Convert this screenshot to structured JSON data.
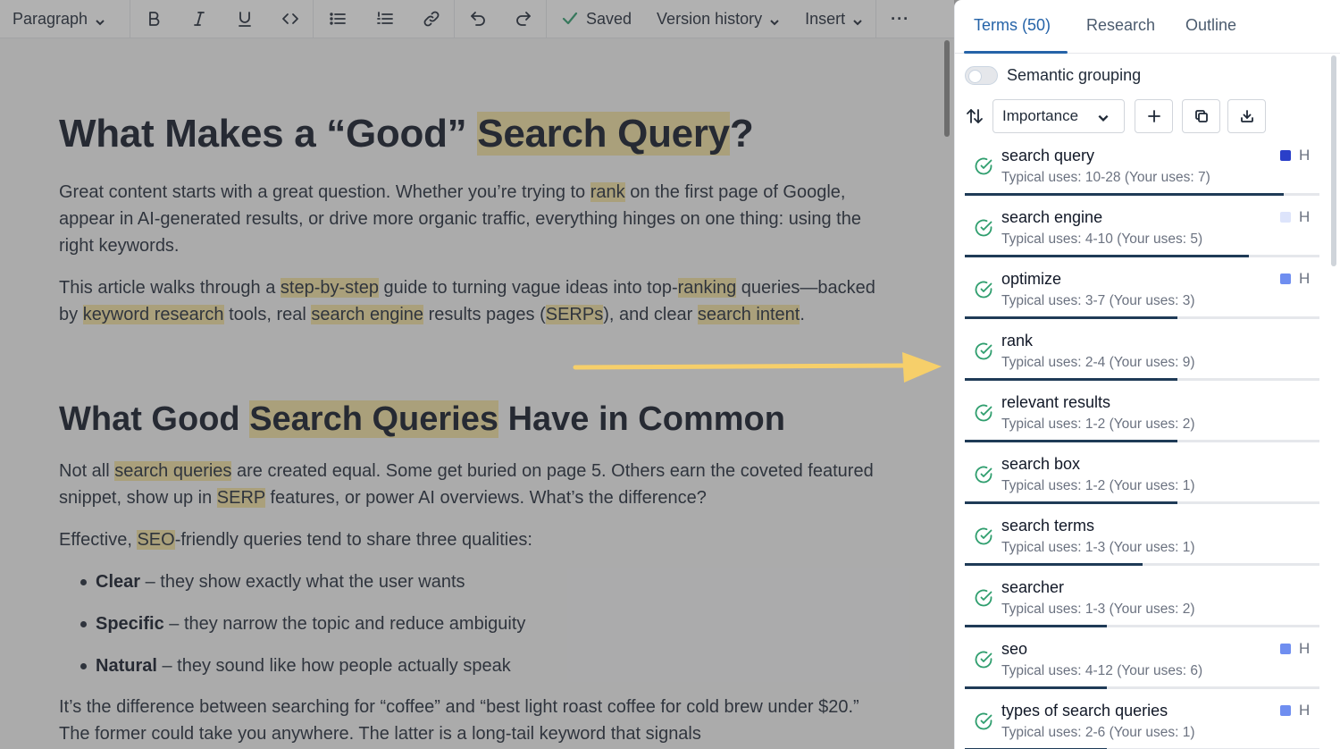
{
  "toolbar": {
    "paragraph_label": "Paragraph",
    "saved_label": "Saved",
    "version_history_label": "Version history",
    "insert_label": "Insert",
    "more_label": "···"
  },
  "document": {
    "h1_pre": "What Makes a “Good” ",
    "h1_hl": "Search Query",
    "h1_post": "?",
    "p1": {
      "a": "Great content starts with a great question. Whether you’re trying to ",
      "hl1": "rank",
      "b": " on the first page of Google, appear in AI-generated results, or drive more organic traffic, everything hinges on one thing: using the right keywords."
    },
    "p2": {
      "a": "This article walks through a ",
      "hl1": "step-by-step",
      "b": " guide to turning vague ideas into top-",
      "hl2": "ranking",
      "c": " queries—backed by ",
      "hl3": "keyword research",
      "d": " tools, real ",
      "hl4": "search engine",
      "e": " results pages (",
      "hl5": "SERPs",
      "f": "), and clear ",
      "hl6": "search intent",
      "g": "."
    },
    "h2_pre": "What Good ",
    "h2_hl": "Search Queries",
    "h2_post": " Have in Common",
    "p3": {
      "a": "Not all ",
      "hl1": "search queries",
      "b": " are created equal. Some get buried on page 5. Others earn the coveted featured snippet, show up in ",
      "hl2": "SERP",
      "c": " features, or power AI overviews. What’s the difference?"
    },
    "p4": {
      "a": "Effective, ",
      "hl1": "SEO",
      "b": "-friendly queries tend to share three qualities:"
    },
    "bullets": [
      {
        "bold": "Clear",
        "rest": " – they show exactly what the user wants"
      },
      {
        "bold": "Specific",
        "rest": " – they narrow the topic and reduce ambiguity"
      },
      {
        "bold": "Natural",
        "rest": " – they sound like how people actually speak"
      }
    ],
    "p5": "It’s the difference between searching for “coffee” and “best light roast coffee for cold brew under $20.” The former could take you anywhere. The latter is a long-tail keyword that signals"
  },
  "panel": {
    "tabs": [
      {
        "label": "Terms (50)",
        "active": true
      },
      {
        "label": "Research",
        "active": false
      },
      {
        "label": "Outline",
        "active": false
      }
    ],
    "semantic_grouping_label": "Semantic grouping",
    "sort_label": "Importance",
    "colors": {
      "accent": "#2563a8",
      "check": "#2f9e6e",
      "progress": "#1f3b57",
      "swatch_dark": "#2a3fc9",
      "swatch_light": "#dde4fb",
      "swatch_mid": "#6f8ef0"
    },
    "terms": [
      {
        "name": "search query",
        "uses": "Typical uses: 10-28 (Your uses: 7)",
        "progress": 0.9,
        "mark": "H",
        "swatch": "#2a3fc9"
      },
      {
        "name": "search engine",
        "uses": "Typical uses: 4-10 (Your uses: 5)",
        "progress": 0.8,
        "mark": "H",
        "swatch": "#dde4fb"
      },
      {
        "name": "optimize",
        "uses": "Typical uses: 3-7 (Your uses: 3)",
        "progress": 0.6,
        "mark": "H",
        "swatch": "#6f8ef0"
      },
      {
        "name": "rank",
        "uses": "Typical uses: 2-4 (Your uses: 9)",
        "progress": 0.6,
        "mark": "",
        "swatch": ""
      },
      {
        "name": "relevant results",
        "uses": "Typical uses: 1-2 (Your uses: 2)",
        "progress": 0.6,
        "mark": "",
        "swatch": ""
      },
      {
        "name": "search box",
        "uses": "Typical uses: 1-2 (Your uses: 1)",
        "progress": 0.6,
        "mark": "",
        "swatch": ""
      },
      {
        "name": "search terms",
        "uses": "Typical uses: 1-3 (Your uses: 1)",
        "progress": 0.5,
        "mark": "",
        "swatch": ""
      },
      {
        "name": "searcher",
        "uses": "Typical uses: 1-3 (Your uses: 2)",
        "progress": 0.4,
        "mark": "",
        "swatch": ""
      },
      {
        "name": "seo",
        "uses": "Typical uses: 4-12 (Your uses: 6)",
        "progress": 0.4,
        "mark": "H",
        "swatch": "#6f8ef0"
      },
      {
        "name": "types of search queries",
        "uses": "Typical uses: 2-6 (Your uses: 1)",
        "progress": 0.4,
        "mark": "H",
        "swatch": "#6f8ef0"
      }
    ]
  }
}
